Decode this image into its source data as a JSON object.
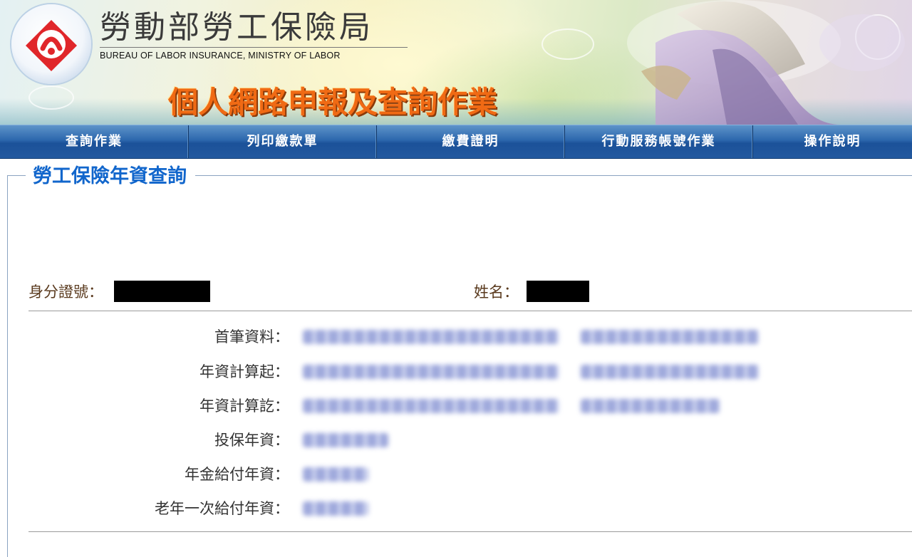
{
  "header": {
    "org_name_cn": "勞動部勞工保險局",
    "org_name_en": "BUREAU OF LABOR INSURANCE, MINISTRY OF LABOR",
    "service_title": "個人網路申報及查詢作業"
  },
  "nav": {
    "items": [
      {
        "label": "查詢作業"
      },
      {
        "label": "列印繳款單"
      },
      {
        "label": "繳費證明"
      },
      {
        "label": "行動服務帳號作業"
      },
      {
        "label": "操作說明"
      }
    ]
  },
  "section": {
    "title": "勞工保險年資查詢"
  },
  "identity": {
    "id_label": "身分證號：",
    "name_label": "姓名："
  },
  "records": [
    {
      "label": "首筆資料："
    },
    {
      "label": "年資計算起："
    },
    {
      "label": "年資計算訖："
    },
    {
      "label": "投保年資："
    },
    {
      "label": "年金給付年資："
    },
    {
      "label": "老年一次給付年資："
    }
  ],
  "colors": {
    "nav_bg": "#2c67ad",
    "section_title": "#1166cc",
    "service_title": "#f06a14"
  }
}
